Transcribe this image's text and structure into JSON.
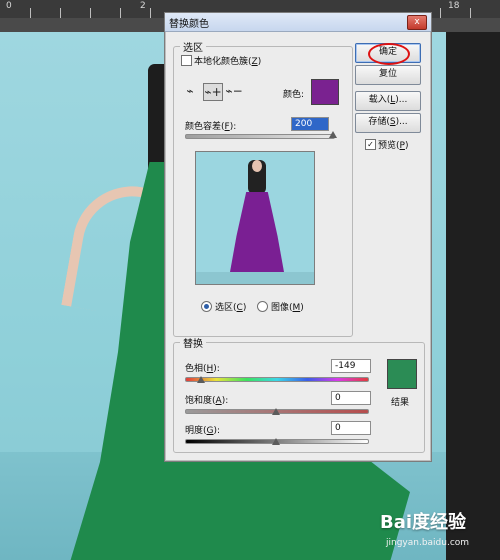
{
  "ruler": {
    "numbers": [
      "0",
      "2",
      "18"
    ]
  },
  "colors": {
    "selected_color": "#7a2290",
    "result_color": "#2b8c55",
    "dress_green": "#1f8a4c",
    "canvas_bg": "#9fd7e0"
  },
  "dialog": {
    "title": "替换颜色",
    "close_symbol": "x",
    "selection": {
      "legend": "选区",
      "localized_checkbox_label": "本地化颜色簇(",
      "localized_checkbox_key": "Z",
      "localized_checkbox_end": ")",
      "eyedropper_icons": [
        "eyedropper-icon",
        "eyedropper-plus-icon",
        "eyedropper-minus-icon"
      ],
      "color_label": "颜色:",
      "tolerance_label": "颜色容差(",
      "tolerance_key": "F",
      "tolerance_end": "):",
      "tolerance_value": "200",
      "tolerance_fraction": 1.0,
      "radio_selection_label": "选区(",
      "radio_selection_key": "C",
      "radio_image_label": "图像(",
      "radio_image_key": "M",
      "radio_end": ")"
    },
    "replace": {
      "legend": "替换",
      "hue_label": "色相(",
      "hue_key": "H",
      "hue_end": "):",
      "hue_value": "-149",
      "saturation_label": "饱和度(",
      "saturation_key": "A",
      "saturation_end": "):",
      "saturation_value": "0",
      "lightness_label": "明度(",
      "lightness_key": "G",
      "lightness_end": "):",
      "lightness_value": "0",
      "result_label": "结果"
    },
    "buttons": {
      "ok": "确定",
      "reset": "复位",
      "load_prefix": "载入(",
      "load_key": "L",
      "load_suffix": ")...",
      "save_prefix": "存储(",
      "save_key": "S",
      "save_suffix": ")...",
      "preview_prefix": "预览(",
      "preview_key": "P",
      "preview_suffix": ")",
      "check_mark": "✓"
    }
  },
  "watermark": {
    "main": "Bai度经验",
    "sub": "jingyan.baidu.com"
  }
}
